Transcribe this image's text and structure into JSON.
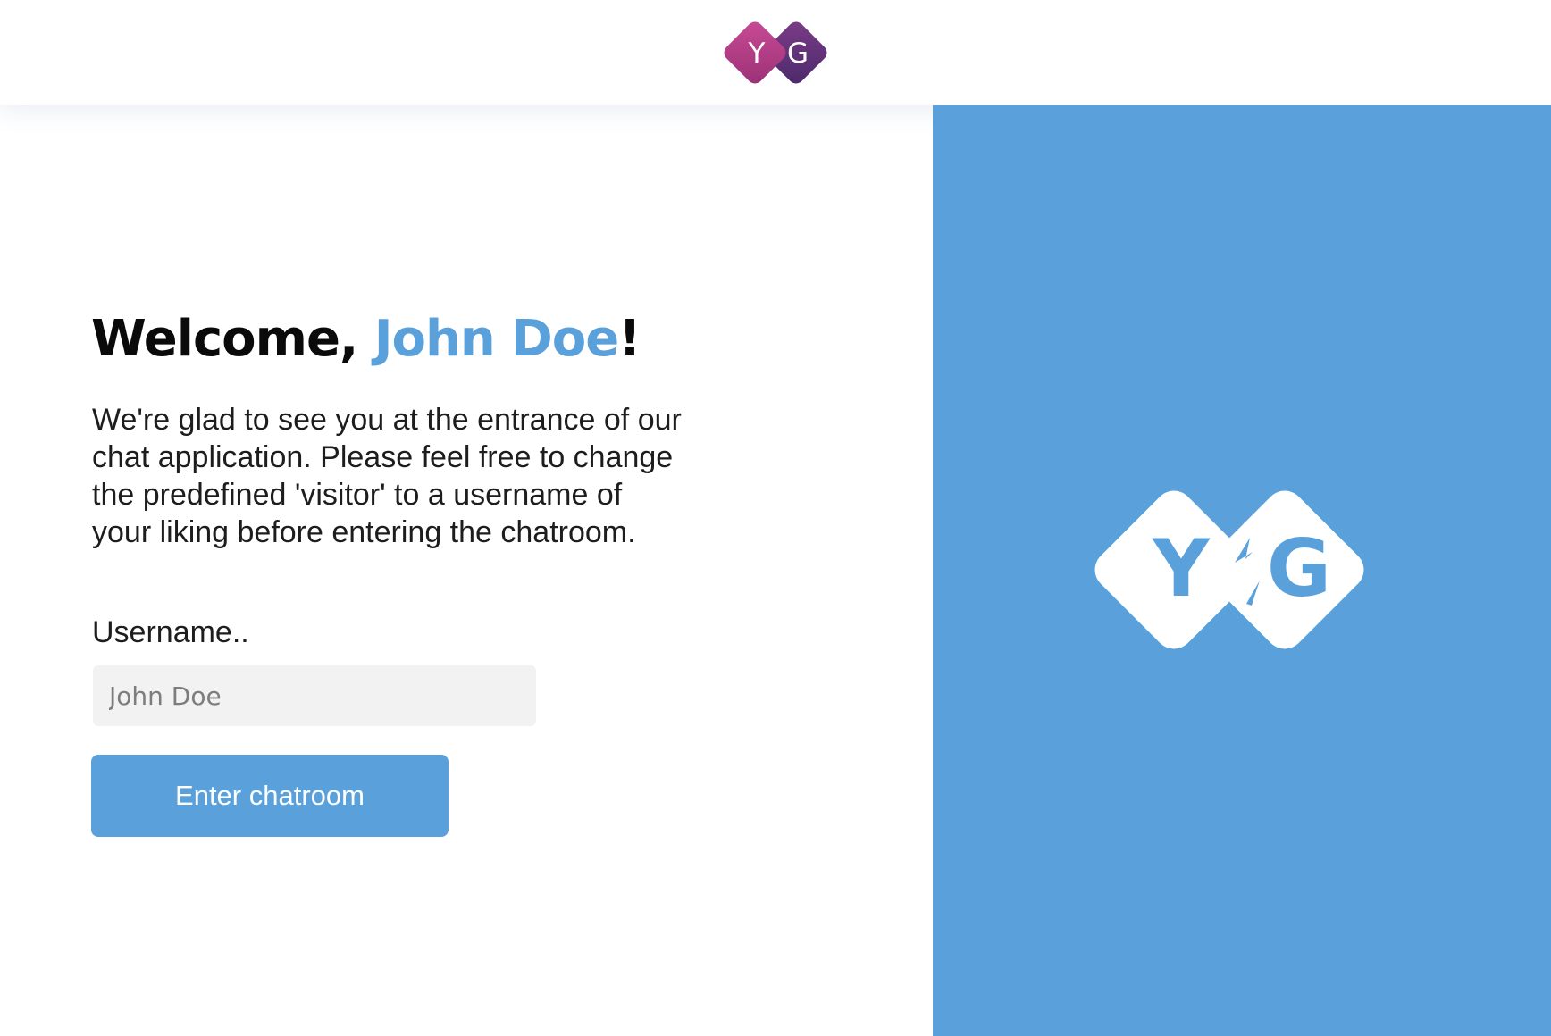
{
  "header": {
    "logo": {
      "icon": "yg-diamond-logo-icon",
      "letters": [
        "Y",
        "G"
      ],
      "colors": [
        "#b13c82",
        "#5d3274"
      ]
    }
  },
  "welcome": {
    "greeting": "Welcome, ",
    "name": "John Doe",
    "punctuation": "!"
  },
  "intro_text": "We're glad to see you at the entrance of our chat application. Please feel free to change the predefined 'visitor' to a username of your liking before entering the chatroom.",
  "form": {
    "username_label": "Username..",
    "username_placeholder": "John Doe",
    "username_value": "",
    "submit_label": "Enter chatroom"
  },
  "hero": {
    "background": "#5aa1dc",
    "logo": {
      "icon": "yg-diamond-logo-icon",
      "letters": [
        "Y",
        "G"
      ],
      "color": "#ffffff"
    }
  },
  "colors": {
    "accent": "#5aa1dc",
    "text": "#0a0a0a",
    "input_background": "#f2f2f2"
  }
}
